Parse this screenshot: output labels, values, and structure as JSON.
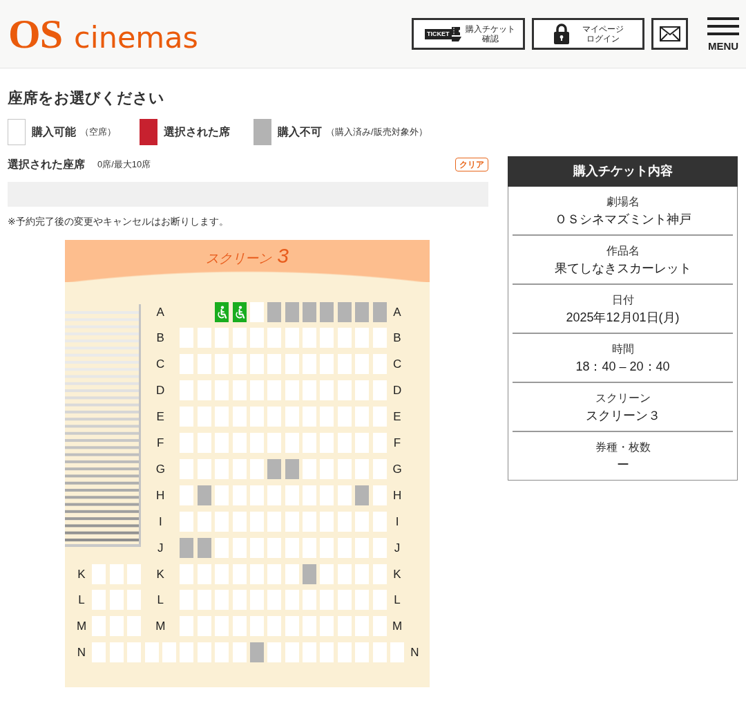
{
  "header": {
    "logo": {
      "mark": "OS",
      "name": "cinemas"
    },
    "buttons": [
      {
        "kind": "ticket",
        "badge": "TICKET",
        "lines": [
          "購入チケット",
          "確認"
        ]
      },
      {
        "kind": "login",
        "lines": [
          "マイページ",
          "ログイン"
        ]
      },
      {
        "kind": "mail"
      }
    ],
    "menu": {
      "label": "MENU"
    }
  },
  "title": "座席をお選びください",
  "legend": [
    {
      "kind": "available",
      "label": "購入可能",
      "note": "（空席）",
      "color": "#ffffff"
    },
    {
      "kind": "selected",
      "label": "選択された席",
      "color": "#c7212f"
    },
    {
      "kind": "unavailable",
      "label": "購入不可",
      "note": "（購入済み/販売対象外）",
      "color": "#b3b3b3"
    }
  ],
  "selection": {
    "label": "選択された座席",
    "count": "0席/最大10席",
    "clear_button": "クリア"
  },
  "notice": "※予約完了後の変更やキャンセルはお断りします。",
  "seat_map": {
    "screen": {
      "label": "スクリーン",
      "number": "3"
    },
    "rows": [
      {
        "kind": "main",
        "labels": [
          "A",
          "A"
        ],
        "seats": [
          {
            "kind": "wheelchair",
            "sold": false,
            "selected": false
          },
          {
            "kind": "wheelchair",
            "sold": false,
            "selected": false
          },
          {
            "kind": "standard",
            "sold": false,
            "selected": false
          },
          {
            "kind": "standard",
            "sold": true,
            "selected": false
          },
          {
            "kind": "standard",
            "sold": true,
            "selected": false
          },
          {
            "kind": "standard",
            "sold": true,
            "selected": false
          },
          {
            "kind": "standard",
            "sold": true,
            "selected": false
          },
          {
            "kind": "standard",
            "sold": true,
            "selected": false
          },
          {
            "kind": "standard",
            "sold": true,
            "selected": false
          },
          {
            "kind": "standard",
            "sold": true,
            "selected": false
          }
        ]
      },
      {
        "kind": "main",
        "labels": [
          "B",
          "B"
        ],
        "seats": [
          {
            "kind": "standard",
            "sold": false,
            "selected": false
          },
          {
            "kind": "standard",
            "sold": false,
            "selected": false
          },
          {
            "kind": "standard",
            "sold": false,
            "selected": false
          },
          {
            "kind": "standard",
            "sold": false,
            "selected": false
          },
          {
            "kind": "standard",
            "sold": false,
            "selected": false
          },
          {
            "kind": "standard",
            "sold": false,
            "selected": false
          },
          {
            "kind": "standard",
            "sold": false,
            "selected": false
          },
          {
            "kind": "standard",
            "sold": false,
            "selected": false
          },
          {
            "kind": "standard",
            "sold": false,
            "selected": false
          },
          {
            "kind": "standard",
            "sold": false,
            "selected": false
          },
          {
            "kind": "standard",
            "sold": false,
            "selected": false
          },
          {
            "kind": "standard",
            "sold": false,
            "selected": false
          }
        ]
      },
      {
        "kind": "main",
        "labels": [
          "C",
          "C"
        ],
        "seats": [
          {
            "kind": "standard",
            "sold": false,
            "selected": false
          },
          {
            "kind": "standard",
            "sold": false,
            "selected": false
          },
          {
            "kind": "standard",
            "sold": false,
            "selected": false
          },
          {
            "kind": "standard",
            "sold": false,
            "selected": false
          },
          {
            "kind": "standard",
            "sold": false,
            "selected": false
          },
          {
            "kind": "standard",
            "sold": false,
            "selected": false
          },
          {
            "kind": "standard",
            "sold": false,
            "selected": false
          },
          {
            "kind": "standard",
            "sold": false,
            "selected": false
          },
          {
            "kind": "standard",
            "sold": false,
            "selected": false
          },
          {
            "kind": "standard",
            "sold": false,
            "selected": false
          },
          {
            "kind": "standard",
            "sold": false,
            "selected": false
          },
          {
            "kind": "standard",
            "sold": false,
            "selected": false
          }
        ]
      },
      {
        "kind": "main",
        "labels": [
          "D",
          "D"
        ],
        "seats": [
          {
            "kind": "standard",
            "sold": false,
            "selected": false
          },
          {
            "kind": "standard",
            "sold": false,
            "selected": false
          },
          {
            "kind": "standard",
            "sold": false,
            "selected": false
          },
          {
            "kind": "standard",
            "sold": false,
            "selected": false
          },
          {
            "kind": "standard",
            "sold": false,
            "selected": false
          },
          {
            "kind": "standard",
            "sold": false,
            "selected": false
          },
          {
            "kind": "standard",
            "sold": false,
            "selected": false
          },
          {
            "kind": "standard",
            "sold": false,
            "selected": false
          },
          {
            "kind": "standard",
            "sold": false,
            "selected": false
          },
          {
            "kind": "standard",
            "sold": false,
            "selected": false
          },
          {
            "kind": "standard",
            "sold": false,
            "selected": false
          },
          {
            "kind": "standard",
            "sold": false,
            "selected": false
          }
        ]
      },
      {
        "kind": "main",
        "labels": [
          "E",
          "E"
        ],
        "seats": [
          {
            "kind": "standard",
            "sold": false,
            "selected": false
          },
          {
            "kind": "standard",
            "sold": false,
            "selected": false
          },
          {
            "kind": "standard",
            "sold": false,
            "selected": false
          },
          {
            "kind": "standard",
            "sold": false,
            "selected": false
          },
          {
            "kind": "standard",
            "sold": false,
            "selected": false
          },
          {
            "kind": "standard",
            "sold": false,
            "selected": false
          },
          {
            "kind": "standard",
            "sold": false,
            "selected": false
          },
          {
            "kind": "standard",
            "sold": false,
            "selected": false
          },
          {
            "kind": "standard",
            "sold": false,
            "selected": false
          },
          {
            "kind": "standard",
            "sold": false,
            "selected": false
          },
          {
            "kind": "standard",
            "sold": false,
            "selected": false
          },
          {
            "kind": "standard",
            "sold": false,
            "selected": false
          }
        ]
      },
      {
        "kind": "main",
        "labels": [
          "F",
          "F"
        ],
        "seats": [
          {
            "kind": "standard",
            "sold": false,
            "selected": false
          },
          {
            "kind": "standard",
            "sold": false,
            "selected": false
          },
          {
            "kind": "standard",
            "sold": false,
            "selected": false
          },
          {
            "kind": "standard",
            "sold": false,
            "selected": false
          },
          {
            "kind": "standard",
            "sold": false,
            "selected": false
          },
          {
            "kind": "standard",
            "sold": false,
            "selected": false
          },
          {
            "kind": "standard",
            "sold": false,
            "selected": false
          },
          {
            "kind": "standard",
            "sold": false,
            "selected": false
          },
          {
            "kind": "standard",
            "sold": false,
            "selected": false
          },
          {
            "kind": "standard",
            "sold": false,
            "selected": false
          },
          {
            "kind": "standard",
            "sold": false,
            "selected": false
          },
          {
            "kind": "standard",
            "sold": false,
            "selected": false
          }
        ]
      },
      {
        "kind": "main",
        "labels": [
          "G",
          "G"
        ],
        "seats": [
          {
            "kind": "standard",
            "sold": false,
            "selected": false
          },
          {
            "kind": "standard",
            "sold": false,
            "selected": false
          },
          {
            "kind": "standard",
            "sold": false,
            "selected": false
          },
          {
            "kind": "standard",
            "sold": false,
            "selected": false
          },
          {
            "kind": "standard",
            "sold": false,
            "selected": false
          },
          {
            "kind": "standard",
            "sold": true,
            "selected": false
          },
          {
            "kind": "standard",
            "sold": true,
            "selected": false
          },
          {
            "kind": "standard",
            "sold": false,
            "selected": false
          },
          {
            "kind": "standard",
            "sold": false,
            "selected": false
          },
          {
            "kind": "standard",
            "sold": false,
            "selected": false
          },
          {
            "kind": "standard",
            "sold": false,
            "selected": false
          },
          {
            "kind": "standard",
            "sold": false,
            "selected": false
          }
        ]
      },
      {
        "kind": "main",
        "labels": [
          "H",
          "H"
        ],
        "seats": [
          {
            "kind": "standard",
            "sold": false,
            "selected": false
          },
          {
            "kind": "standard",
            "sold": true,
            "selected": false
          },
          {
            "kind": "standard",
            "sold": false,
            "selected": false
          },
          {
            "kind": "standard",
            "sold": false,
            "selected": false
          },
          {
            "kind": "standard",
            "sold": false,
            "selected": false
          },
          {
            "kind": "standard",
            "sold": false,
            "selected": false
          },
          {
            "kind": "standard",
            "sold": false,
            "selected": false
          },
          {
            "kind": "standard",
            "sold": false,
            "selected": false
          },
          {
            "kind": "standard",
            "sold": false,
            "selected": false
          },
          {
            "kind": "standard",
            "sold": false,
            "selected": false
          },
          {
            "kind": "standard",
            "sold": true,
            "selected": false
          },
          {
            "kind": "standard",
            "sold": false,
            "selected": false
          }
        ]
      },
      {
        "kind": "main",
        "labels": [
          "I",
          "I"
        ],
        "seats": [
          {
            "kind": "standard",
            "sold": false,
            "selected": false
          },
          {
            "kind": "standard",
            "sold": false,
            "selected": false
          },
          {
            "kind": "standard",
            "sold": false,
            "selected": false
          },
          {
            "kind": "standard",
            "sold": false,
            "selected": false
          },
          {
            "kind": "standard",
            "sold": false,
            "selected": false
          },
          {
            "kind": "standard",
            "sold": false,
            "selected": false
          },
          {
            "kind": "standard",
            "sold": false,
            "selected": false
          },
          {
            "kind": "standard",
            "sold": false,
            "selected": false
          },
          {
            "kind": "standard",
            "sold": false,
            "selected": false
          },
          {
            "kind": "standard",
            "sold": false,
            "selected": false
          },
          {
            "kind": "standard",
            "sold": false,
            "selected": false
          },
          {
            "kind": "standard",
            "sold": false,
            "selected": false
          }
        ]
      },
      {
        "kind": "main",
        "labels": [
          "J",
          "J"
        ],
        "seats": [
          {
            "kind": "standard",
            "sold": true,
            "selected": false
          },
          {
            "kind": "standard",
            "sold": true,
            "selected": false
          },
          {
            "kind": "standard",
            "sold": false,
            "selected": false
          },
          {
            "kind": "standard",
            "sold": false,
            "selected": false
          },
          {
            "kind": "standard",
            "sold": false,
            "selected": false
          },
          {
            "kind": "standard",
            "sold": false,
            "selected": false
          },
          {
            "kind": "standard",
            "sold": false,
            "selected": false
          },
          {
            "kind": "standard",
            "sold": false,
            "selected": false
          },
          {
            "kind": "standard",
            "sold": false,
            "selected": false
          },
          {
            "kind": "standard",
            "sold": false,
            "selected": false
          },
          {
            "kind": "standard",
            "sold": false,
            "selected": false
          },
          {
            "kind": "standard",
            "sold": false,
            "selected": false
          }
        ]
      },
      {
        "kind": "side",
        "labels": [
          "K",
          "K",
          "K"
        ],
        "side_seats": [
          {
            "kind": "standard",
            "sold": false,
            "selected": false
          },
          {
            "kind": "standard",
            "sold": false,
            "selected": false
          },
          {
            "kind": "standard",
            "sold": false,
            "selected": false
          }
        ],
        "seats": [
          {
            "kind": "standard",
            "sold": false,
            "selected": false
          },
          {
            "kind": "standard",
            "sold": false,
            "selected": false
          },
          {
            "kind": "standard",
            "sold": false,
            "selected": false
          },
          {
            "kind": "standard",
            "sold": false,
            "selected": false
          },
          {
            "kind": "standard",
            "sold": false,
            "selected": false
          },
          {
            "kind": "standard",
            "sold": false,
            "selected": false
          },
          {
            "kind": "standard",
            "sold": false,
            "selected": false
          },
          {
            "kind": "standard",
            "sold": true,
            "selected": false
          },
          {
            "kind": "standard",
            "sold": false,
            "selected": false
          },
          {
            "kind": "standard",
            "sold": false,
            "selected": false
          },
          {
            "kind": "standard",
            "sold": false,
            "selected": false
          },
          {
            "kind": "standard",
            "sold": false,
            "selected": false
          }
        ]
      },
      {
        "kind": "side",
        "labels": [
          "L",
          "L",
          "L"
        ],
        "side_seats": [
          {
            "kind": "standard",
            "sold": false,
            "selected": false
          },
          {
            "kind": "standard",
            "sold": false,
            "selected": false
          },
          {
            "kind": "standard",
            "sold": false,
            "selected": false
          }
        ],
        "seats": [
          {
            "kind": "standard",
            "sold": false,
            "selected": false
          },
          {
            "kind": "standard",
            "sold": false,
            "selected": false
          },
          {
            "kind": "standard",
            "sold": false,
            "selected": false
          },
          {
            "kind": "standard",
            "sold": false,
            "selected": false
          },
          {
            "kind": "standard",
            "sold": false,
            "selected": false
          },
          {
            "kind": "standard",
            "sold": false,
            "selected": false
          },
          {
            "kind": "standard",
            "sold": false,
            "selected": false
          },
          {
            "kind": "standard",
            "sold": false,
            "selected": false
          },
          {
            "kind": "standard",
            "sold": false,
            "selected": false
          },
          {
            "kind": "standard",
            "sold": false,
            "selected": false
          },
          {
            "kind": "standard",
            "sold": false,
            "selected": false
          },
          {
            "kind": "standard",
            "sold": false,
            "selected": false
          }
        ]
      },
      {
        "kind": "side",
        "labels": [
          "M",
          "M",
          "M"
        ],
        "side_seats": [
          {
            "kind": "standard",
            "sold": false,
            "selected": false
          },
          {
            "kind": "standard",
            "sold": false,
            "selected": false
          },
          {
            "kind": "standard",
            "sold": false,
            "selected": false
          }
        ],
        "seats": [
          {
            "kind": "standard",
            "sold": false,
            "selected": false
          },
          {
            "kind": "standard",
            "sold": false,
            "selected": false
          },
          {
            "kind": "standard",
            "sold": false,
            "selected": false
          },
          {
            "kind": "standard",
            "sold": false,
            "selected": false
          },
          {
            "kind": "standard",
            "sold": false,
            "selected": false
          },
          {
            "kind": "standard",
            "sold": false,
            "selected": false
          },
          {
            "kind": "standard",
            "sold": false,
            "selected": false
          },
          {
            "kind": "standard",
            "sold": false,
            "selected": false
          },
          {
            "kind": "standard",
            "sold": false,
            "selected": false
          },
          {
            "kind": "standard",
            "sold": false,
            "selected": false
          },
          {
            "kind": "standard",
            "sold": false,
            "selected": false
          },
          {
            "kind": "standard",
            "sold": false,
            "selected": false
          }
        ]
      },
      {
        "kind": "full",
        "labels": [
          "N",
          "N"
        ],
        "seats": [
          {
            "kind": "standard",
            "sold": false,
            "selected": false
          },
          {
            "kind": "standard",
            "sold": false,
            "selected": false
          },
          {
            "kind": "standard",
            "sold": false,
            "selected": false
          },
          {
            "kind": "standard",
            "sold": false,
            "selected": false
          },
          {
            "kind": "standard",
            "sold": false,
            "selected": false
          },
          {
            "kind": "standard",
            "sold": false,
            "selected": false
          },
          {
            "kind": "standard",
            "sold": false,
            "selected": false
          },
          {
            "kind": "standard",
            "sold": false,
            "selected": false
          },
          {
            "kind": "standard",
            "sold": false,
            "selected": false
          },
          {
            "kind": "standard",
            "sold": true,
            "selected": false
          },
          {
            "kind": "standard",
            "sold": false,
            "selected": false
          },
          {
            "kind": "standard",
            "sold": false,
            "selected": false
          },
          {
            "kind": "standard",
            "sold": false,
            "selected": false
          },
          {
            "kind": "standard",
            "sold": false,
            "selected": false
          },
          {
            "kind": "standard",
            "sold": false,
            "selected": false
          },
          {
            "kind": "standard",
            "sold": false,
            "selected": false
          },
          {
            "kind": "standard",
            "sold": false,
            "selected": false
          },
          {
            "kind": "standard",
            "sold": false,
            "selected": false
          }
        ]
      }
    ]
  },
  "ticket_summary": {
    "title": "購入チケット内容",
    "items": [
      {
        "label": "劇場名",
        "value": "ＯＳシネマズミント神戸"
      },
      {
        "label": "作品名",
        "value": "果てしなきスカーレット"
      },
      {
        "label": "日付",
        "value": "2025年12月01日(月)"
      },
      {
        "label": "時間",
        "value": "18：40 – 20：40"
      },
      {
        "label": "スクリーン",
        "value": "スクリーン３"
      },
      {
        "label": "券種・枚数",
        "value": "ー"
      }
    ]
  }
}
